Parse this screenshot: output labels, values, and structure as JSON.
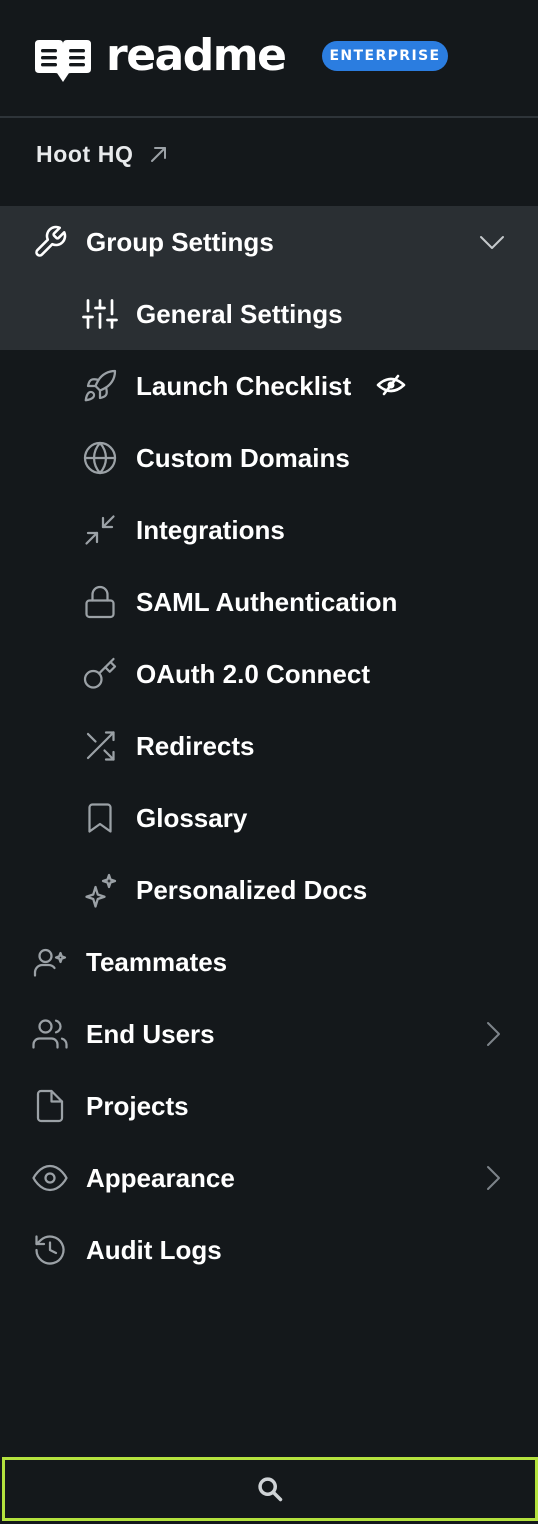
{
  "brand": {
    "name": "readme",
    "badge": "ENTERPRISE",
    "badge_color": "#2b7de0"
  },
  "workspace": {
    "label": "Hoot HQ",
    "icon": "external-arrow-icon"
  },
  "nav": {
    "group_settings": {
      "label": "Group Settings",
      "icon": "wrench-icon",
      "expanded": true,
      "children": [
        {
          "label": "General Settings",
          "icon": "sliders-icon",
          "active": true
        },
        {
          "label": "Launch Checklist",
          "icon": "rocket-icon",
          "suffix_icon": "eye-off-icon"
        },
        {
          "label": "Custom Domains",
          "icon": "globe-icon"
        },
        {
          "label": "Integrations",
          "icon": "arrows-in-icon"
        },
        {
          "label": "SAML Authentication",
          "icon": "lock-icon"
        },
        {
          "label": "OAuth 2.0 Connect",
          "icon": "key-icon"
        },
        {
          "label": "Redirects",
          "icon": "shuffle-icon"
        },
        {
          "label": "Glossary",
          "icon": "bookmark-icon"
        },
        {
          "label": "Personalized Docs",
          "icon": "sparkles-icon"
        }
      ]
    },
    "items": [
      {
        "label": "Teammates",
        "icon": "user-star-icon"
      },
      {
        "label": "End Users",
        "icon": "users-icon",
        "has_chevron": true
      },
      {
        "label": "Projects",
        "icon": "file-icon"
      },
      {
        "label": "Appearance",
        "icon": "eye-icon",
        "has_chevron": true
      },
      {
        "label": "Audit Logs",
        "icon": "history-icon"
      }
    ]
  },
  "search": {
    "icon": "search-icon",
    "highlight_color": "#b4e23e"
  },
  "colors": {
    "background": "#14181b",
    "active_background": "#2a2f33",
    "icon": "#9ba1a6",
    "text": "#ffffff"
  }
}
